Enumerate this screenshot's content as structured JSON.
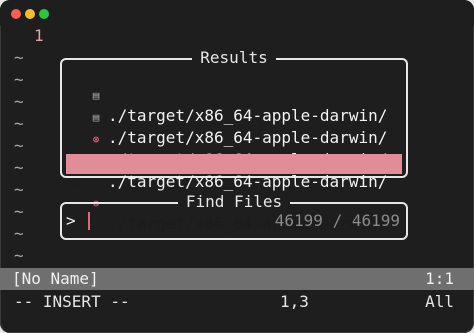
{
  "window": {
    "controls": [
      "close",
      "minimize",
      "zoom"
    ],
    "colors": {
      "close": "#ff5f57",
      "minimize": "#febc2e",
      "zoom": "#28c840"
    }
  },
  "editor": {
    "line_number": "1",
    "tilde": "~"
  },
  "results": {
    "title": "Results",
    "selected_marker": ">",
    "items": [
      {
        "icon": "file-icon",
        "glyph": "▤",
        "path": "./target/x86_64-apple-darwin/"
      },
      {
        "icon": "file-icon",
        "glyph": "▤",
        "path": "./target/x86_64-apple-darwin/"
      },
      {
        "icon": "settings-icon",
        "glyph": "⊛",
        "path": "./target/x86_64-apple-darwin/"
      },
      {
        "icon": "file-icon",
        "glyph": "▤",
        "path": "./target/x86_64-apple-darwin/"
      },
      {
        "icon": "settings-icon",
        "glyph": "⊛",
        "path": "./target/x86_64-apple-darwin/"
      }
    ]
  },
  "find": {
    "title": "Find Files",
    "prompt": ">",
    "count": "46199 / 46199"
  },
  "status": {
    "buffer_name": "[No Name]",
    "position": "1:1"
  },
  "mode_line": {
    "mode": "-- INSERT --",
    "cursor": "1,3",
    "scroll": "All"
  },
  "colors": {
    "background": "#1e1e1e",
    "selection": "#e08d98",
    "line_number": "#e8a0a8",
    "cursor": "#e0697a",
    "statusbar": "#6f6f6f"
  }
}
